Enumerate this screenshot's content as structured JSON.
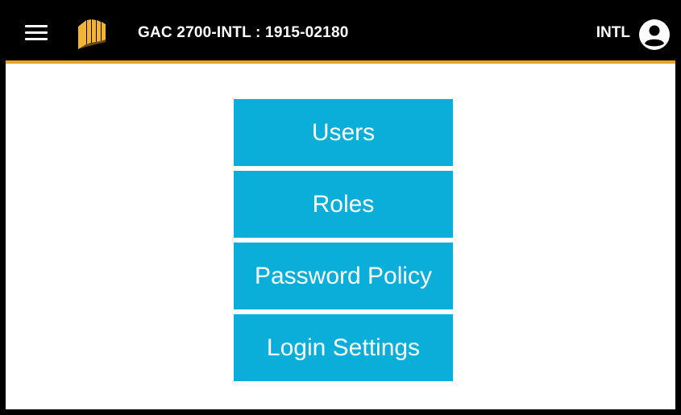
{
  "header": {
    "title": "GAC 2700-INTL : 1915-02180",
    "user": "INTL",
    "menu_icon": "hamburger-menu-icon",
    "logo_icon": "company-logo",
    "account_icon": "account-circle-icon",
    "accent_color": "#e7a526",
    "background_color": "#000000"
  },
  "menu": {
    "button_color": "#0aaed8",
    "items": [
      {
        "label": "Users"
      },
      {
        "label": "Roles"
      },
      {
        "label": "Password Policy"
      },
      {
        "label": "Login Settings"
      }
    ]
  }
}
